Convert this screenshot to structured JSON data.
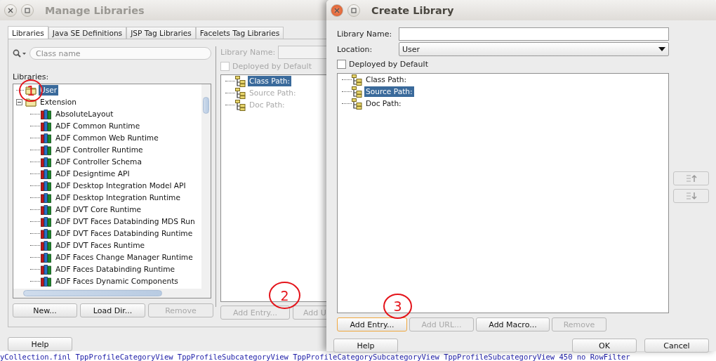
{
  "manage_window": {
    "title": "Manage Libraries",
    "tabs": [
      {
        "label": "Libraries",
        "selected": true
      },
      {
        "label": "Java SE Definitions",
        "selected": false
      },
      {
        "label": "JSP Tag Libraries",
        "selected": false
      },
      {
        "label": "Facelets Tag Libraries",
        "selected": false
      }
    ],
    "search": {
      "placeholder": "Class name"
    },
    "libraries_label": "Libraries:",
    "tree": [
      {
        "label": "User",
        "kind": "folder",
        "selected": true
      },
      {
        "label": "Extension",
        "kind": "folder",
        "selected": false,
        "expanded": true,
        "children": [
          {
            "label": "AbsoluteLayout",
            "kind": "library",
            "selected": false
          },
          {
            "label": "ADF Common Runtime",
            "kind": "library",
            "selected": false
          },
          {
            "label": "ADF Common Web Runtime",
            "kind": "library",
            "selected": false
          },
          {
            "label": "ADF Controller Runtime",
            "kind": "library",
            "selected": false
          },
          {
            "label": "ADF Controller Schema",
            "kind": "library",
            "selected": false
          },
          {
            "label": "ADF Designtime API",
            "kind": "library",
            "selected": false
          },
          {
            "label": "ADF Desktop Integration Model API",
            "kind": "library",
            "selected": false
          },
          {
            "label": "ADF Desktop Integration Runtime",
            "kind": "library",
            "selected": false
          },
          {
            "label": "ADF DVT Core Runtime",
            "kind": "library",
            "selected": false
          },
          {
            "label": "ADF DVT Faces Databinding MDS Run",
            "kind": "library",
            "selected": false
          },
          {
            "label": "ADF DVT Faces Databinding Runtime",
            "kind": "library",
            "selected": false
          },
          {
            "label": "ADF DVT Faces Runtime",
            "kind": "library",
            "selected": false
          },
          {
            "label": "ADF Faces Change Manager Runtime",
            "kind": "library",
            "selected": false
          },
          {
            "label": "ADF Faces Databinding Runtime",
            "kind": "library",
            "selected": false
          },
          {
            "label": "ADF Faces Dynamic Components",
            "kind": "library",
            "selected": false
          }
        ]
      }
    ],
    "buttons": [
      {
        "label": "New...",
        "disabled": false
      },
      {
        "label": "Load Dir...",
        "disabled": false
      },
      {
        "label": "Remove",
        "disabled": true
      }
    ],
    "details": {
      "disabled": true,
      "library_name_label": "Library Name:",
      "deployed": {
        "label": "Deployed by Default",
        "checked": false
      },
      "paths": [
        {
          "label": "Class Path:",
          "selected": true
        },
        {
          "label": "Source Path:",
          "selected": false
        },
        {
          "label": "Doc Path:",
          "selected": false
        }
      ],
      "buttons": [
        {
          "label": "Add Entry...",
          "disabled": true
        },
        {
          "label": "Add U",
          "disabled": true
        }
      ]
    },
    "help": "Help"
  },
  "create_window": {
    "title": "Create Library",
    "library_name_label": "Library Name:",
    "location_label": "Location:",
    "location": "User",
    "deployed": {
      "label": "Deployed by Default",
      "checked": false
    },
    "paths": [
      {
        "label": "Class Path:",
        "selected": false
      },
      {
        "label": "Source Path:",
        "selected": true
      },
      {
        "label": "Doc Path:",
        "selected": false
      }
    ],
    "buttons": [
      {
        "label": "Add Entry...",
        "disabled": false,
        "focused": true
      },
      {
        "label": "Add URL...",
        "disabled": true,
        "focused": false
      },
      {
        "label": "Add Macro...",
        "disabled": false,
        "focused": false
      },
      {
        "label": "Remove",
        "disabled": true,
        "focused": false
      }
    ],
    "help": "Help",
    "ok": "OK",
    "cancel": "Cancel"
  },
  "annotations": [
    {
      "label": "1"
    },
    {
      "label": "2"
    },
    {
      "label": "3"
    }
  ],
  "background_code": "yCollection.finl TppProfileCategoryView TppProfileSubcategoryView TppProfileCategorySubcategoryView TppProfileSubcategoryView 450 no RowFilter"
}
